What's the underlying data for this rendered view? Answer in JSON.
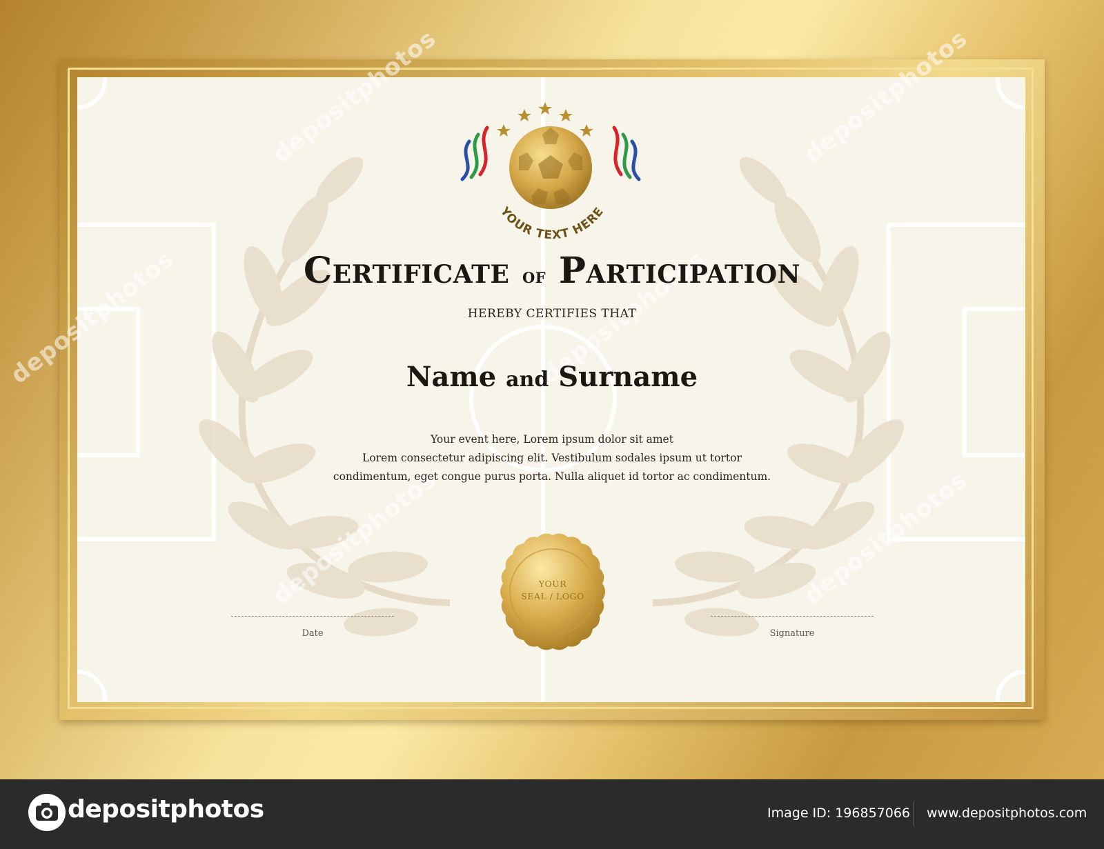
{
  "logo": {
    "arc_text": "YOUR TEXT HERE",
    "stars": 5
  },
  "certificate": {
    "title_main_1": "Certificate",
    "title_of": "of",
    "title_main_2": "Participation",
    "subtitle": "HEREBY CERTIFIES THAT",
    "name_first": "Name",
    "name_and": "and",
    "name_last": "Surname",
    "body_line_1": "Your event here, Lorem ipsum dolor sit amet",
    "body_line_2": "Lorem consectetur adipiscing elit. Vestibulum sodales ipsum ut tortor",
    "body_line_3": "condimentum, eget congue purus porta. Nulla aliquet id tortor ac condimentum.",
    "date_label": "Date",
    "signature_label": "Signature",
    "seal_line_1": "YOUR",
    "seal_line_2": "SEAL / LOGO"
  },
  "watermark": {
    "text": "depositphotos"
  },
  "footer": {
    "brand": "depositphotos",
    "image_id": "Image ID: 196857066",
    "url": "www.depositphotos.com"
  },
  "colors": {
    "gold": "#d4a944",
    "paper": "#f7f4ea",
    "footer": "#2b2b2b",
    "ribbon_red": "#d8232a",
    "ribbon_green": "#2e9a48",
    "ribbon_blue": "#2a4fa8"
  }
}
